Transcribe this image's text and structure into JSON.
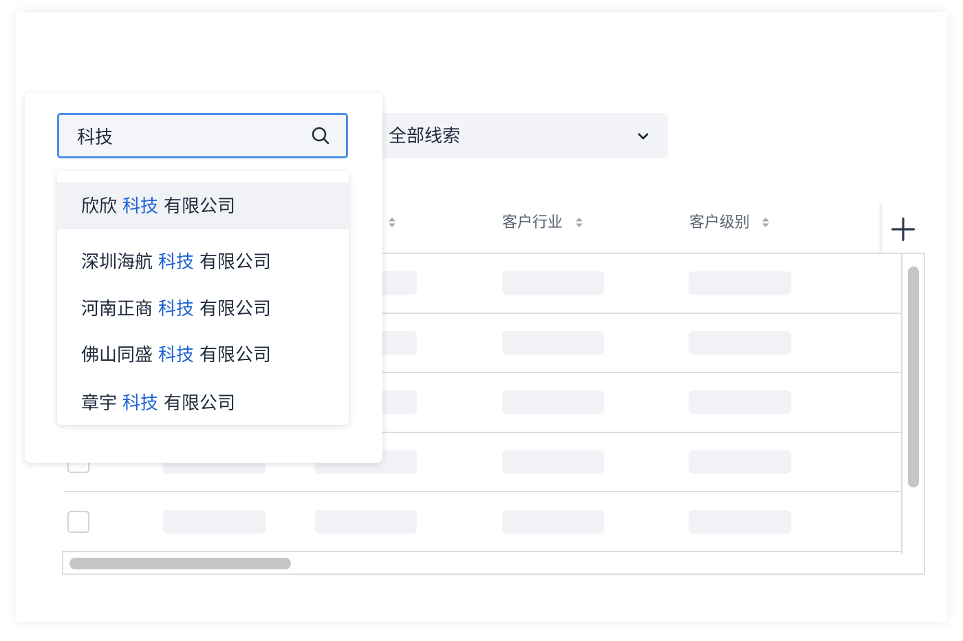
{
  "search": {
    "query": "科技",
    "icon": "search-icon"
  },
  "suggestions": [
    {
      "prefix": "欣欣",
      "match": "科技",
      "suffix": "有限公司",
      "highlighted": true
    },
    {
      "prefix": "深圳海航",
      "match": "科技",
      "suffix": "有限公司",
      "highlighted": false
    },
    {
      "prefix": "河南正商",
      "match": "科技",
      "suffix": "有限公司",
      "highlighted": false
    },
    {
      "prefix": "佛山同盛",
      "match": "科技",
      "suffix": "有限公司",
      "highlighted": false
    },
    {
      "prefix": "章宇",
      "match": "科技",
      "suffix": "有限公司",
      "highlighted": false
    }
  ],
  "filter": {
    "selected": "全部线索",
    "icon": "chevron-down-icon"
  },
  "table": {
    "columns": [
      {
        "label": "客户行业",
        "sort_icon": "sort-icon"
      },
      {
        "label": "客户级别",
        "sort_icon": "sort-icon"
      }
    ],
    "add_column_icon": "plus-icon",
    "rows": [
      {
        "checked": false,
        "loading": true
      },
      {
        "checked": false,
        "loading": true
      },
      {
        "checked": false,
        "loading": true
      },
      {
        "checked": false,
        "loading": true
      },
      {
        "checked": false,
        "loading": true
      }
    ]
  },
  "colors": {
    "accent": "#4a8fe7",
    "match_highlight": "#1a63d6",
    "text": "#1e2a3b",
    "header_text": "#5b6472",
    "skeleton": "#f1f2f6",
    "border": "#dadde3"
  }
}
